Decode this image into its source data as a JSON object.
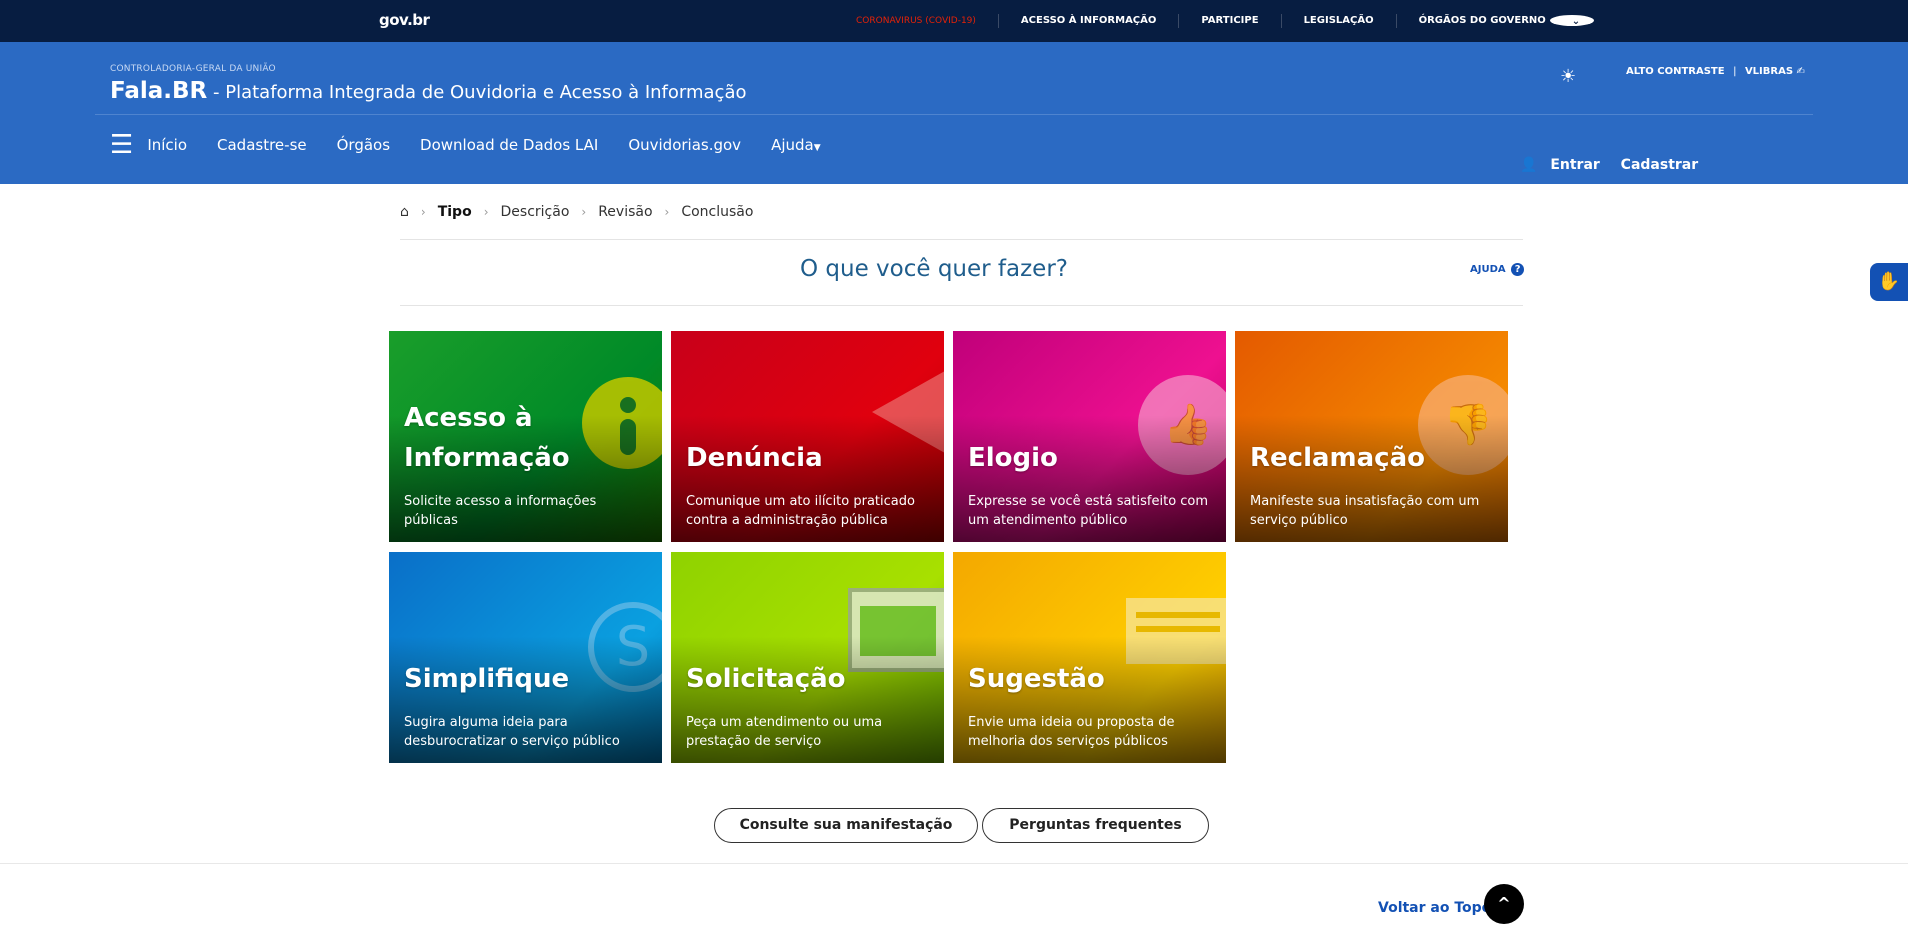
{
  "govbar": {
    "logo": "gov.br",
    "links": [
      "CORONAVIRUS (COVID-19)",
      "ACESSO À INFORMAÇÃO",
      "PARTICIPE",
      "LEGISLAÇÃO",
      "ÓRGÃOS DO GOVERNO"
    ]
  },
  "header": {
    "org": "CONTROLADORIA-GERAL DA UNIÃO",
    "brand": "Fala.BR",
    "subtitle": " - Plataforma Integrada de Ouvidoria e Acesso à Informação",
    "contrast": "ALTO CONTRASTE",
    "vlibras": "VLIBRAS",
    "nav": [
      "Início",
      "Cadastre-se",
      "Órgãos",
      "Download de Dados LAI",
      "Ouvidorias.gov",
      "Ajuda"
    ],
    "login": "Entrar",
    "register": "Cadastrar"
  },
  "breadcrumb": [
    "Tipo",
    "Descrição",
    "Revisão",
    "Conclusão"
  ],
  "question": "O que você quer fazer?",
  "help": "AJUDA",
  "tiles": [
    {
      "name": "Acesso à Informação",
      "desc": "Solicite acesso a informações públicas",
      "color": "#008a28"
    },
    {
      "name": "Denúncia",
      "desc": "Comunique um ato ilícito praticado contra a administração pública",
      "color": "#d40010"
    },
    {
      "name": "Elogio",
      "desc": "Expresse se você está satisfeito com um atendimento público",
      "color": "#d6007a"
    },
    {
      "name": "Reclamação",
      "desc": "Manifeste sua insatisfação com um serviço público",
      "color": "#f07000"
    },
    {
      "name": "Simplifique",
      "desc": "Sugira alguma ideia para desburocratizar o serviço público",
      "color": "#0a86d0"
    },
    {
      "name": "Solicitação",
      "desc": "Peça um atendimento ou uma prestação de serviço",
      "color": "#7cc000"
    },
    {
      "name": "Sugestão",
      "desc": "Envie uma ideia ou proposta de melhoria dos serviços públicos",
      "color": "#f0b800"
    }
  ],
  "buttons": {
    "consult": "Consulte sua manifestação",
    "faq": "Perguntas frequentes"
  },
  "back_to_top": "Voltar ao Topo"
}
